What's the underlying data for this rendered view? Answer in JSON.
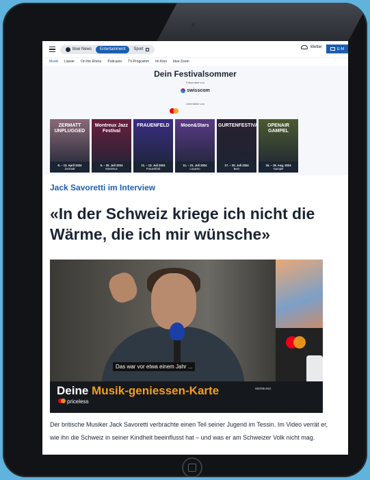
{
  "topbar": {
    "brand_label": "blue News",
    "tabs": [
      {
        "label": "Entertainment",
        "active": true
      },
      {
        "label": "Sport",
        "active": false
      }
    ],
    "weather_label": "Wetter",
    "mail_label": "E-M"
  },
  "subnav": [
    "Musik",
    "Lässer",
    "On the Rocks",
    "Podcasts",
    "TV-Programm",
    "Im Kino",
    "blue Zoom"
  ],
  "festival": {
    "title": "Dein Festivalsommer",
    "presented_label": "Präsentiert von",
    "presenter": "swisscom",
    "supported_label": "Unterstützt von",
    "cards": [
      {
        "name": "ZERMATT UNPLUGGED",
        "date": "9. – 13. April 2024",
        "place": "Zermatt",
        "color": "#8a6a78"
      },
      {
        "name": "Montreux Jazz Festival",
        "date": "5. – 20. Juli 2024",
        "place": "Montreux",
        "color": "#6a1f3f"
      },
      {
        "name": "FRAUENFELD",
        "date": "11. – 13. Juli 2024",
        "place": "Frauenfeld",
        "color": "#3a2e82"
      },
      {
        "name": "Moon&Stars",
        "date": "11. – 21. Juli 2024",
        "place": "Locarno",
        "color": "#5a3a86"
      },
      {
        "name": "GURTENFESTIVAL",
        "date": "17. – 20. Juli 2024",
        "place": "Bern",
        "color": "#2a2030"
      },
      {
        "name": "OPENAIR GAMPEL",
        "date": "15. – 18. Aug. 2024",
        "place": "Gampel",
        "color": "#4d5a30"
      }
    ]
  },
  "article": {
    "kicker": "Jack Savoretti im Interview",
    "headline": "«In der Schweiz kriege ich nicht die Wärme, die ich mir wünsche»",
    "video_subtitle": "Das war vor etwa einem Jahr ...",
    "ad_title_prefix": "Deine ",
    "ad_title_highlight": "Musik-geniessen-Karte",
    "ad_brand": "priceless",
    "ad_tag": "WERBUNG",
    "body": "Der britische Musiker Jack Savoretti verbrachte einen Teil seiner Jugend im Tessin. Im Video verrät er, wie ihn die Schweiz in seiner Kindheit beeinflusst hat – und was er am Schweizer Volk nicht mag."
  }
}
